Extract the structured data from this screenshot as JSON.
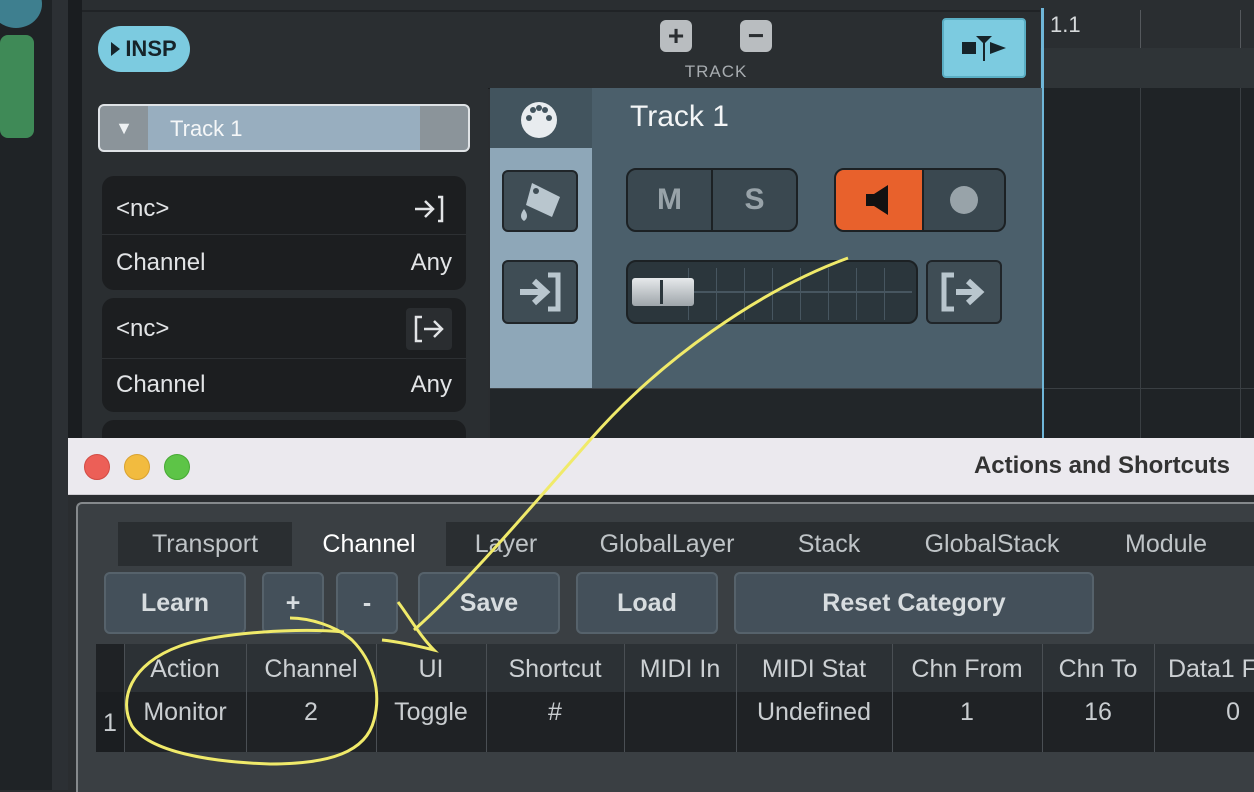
{
  "header": {
    "insp_label": "INSP",
    "track_group_label": "TRACK",
    "add_icon": "plus-square-icon",
    "remove_icon": "minus-square-icon",
    "split_icon": "split-view-icon"
  },
  "timeline": {
    "ruler_label": "1.1"
  },
  "inspector": {
    "track_select": "Track 1",
    "input_card": {
      "port": "<nc>",
      "channel_label": "Channel",
      "channel_value": "Any"
    },
    "output_card": {
      "port": "<nc>",
      "channel_label": "Channel",
      "channel_value": "Any"
    }
  },
  "track": {
    "name": "Track 1",
    "mute_label": "M",
    "solo_label": "S",
    "monitor_color": "#e8612c",
    "accent_color": "#7ccbe0"
  },
  "dialog": {
    "title": "Actions and Shortcuts",
    "tabs": [
      "Transport",
      "Channel",
      "Layer",
      "GlobalLayer",
      "Stack",
      "GlobalStack",
      "Module"
    ],
    "active_tab": "Channel",
    "buttons": {
      "learn": "Learn",
      "add": "+",
      "remove": "-",
      "save": "Save",
      "load": "Load",
      "reset": "Reset Category"
    },
    "table": {
      "columns": [
        "Action",
        "Channel",
        "UI",
        "Shortcut",
        "MIDI In",
        "MIDI Stat",
        "Chn From",
        "Chn To",
        "Data1 F"
      ],
      "rows": [
        {
          "num": "1",
          "cells": [
            "Monitor",
            "2",
            "Toggle",
            "#",
            "",
            "Undefined",
            "1",
            "16",
            "0"
          ]
        }
      ]
    }
  }
}
